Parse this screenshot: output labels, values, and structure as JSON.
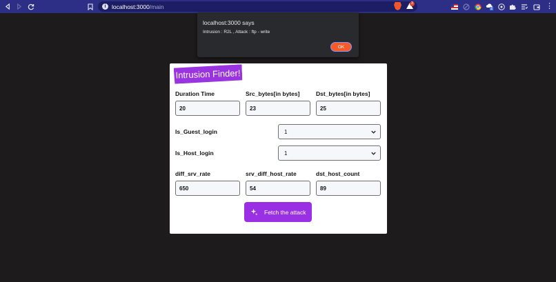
{
  "browser": {
    "url_host": "localhost:3000",
    "url_path": "/main",
    "rewards_count": "3"
  },
  "alert": {
    "title": "localhost:3000 says",
    "message": "Intrusion : R2L , Attack : ftp - write",
    "ok_label": "OK"
  },
  "form": {
    "brand": "Intrusion Finder!",
    "duration": {
      "label": "Duration Time",
      "value": "20"
    },
    "src_bytes": {
      "label": "Src_bytes[in bytes]",
      "value": "23"
    },
    "dst_bytes": {
      "label": "Dst_bytes[in bytes]",
      "value": "25"
    },
    "is_guest_login": {
      "label": "Is_Guest_login",
      "value": "1"
    },
    "is_host_login": {
      "label": "Is_Host_login",
      "value": "1"
    },
    "diff_srv_rate": {
      "label": "diff_srv_rate",
      "value": "650"
    },
    "srv_diff_host_rate": {
      "label": "srv_diff_host_rate",
      "value": "54"
    },
    "dst_host_count": {
      "label": "dst_host_count",
      "value": "89"
    },
    "fetch_label": "Fetch the attack"
  },
  "colors": {
    "toolbar": "#2d2f86",
    "accent_purple": "#9930e3",
    "ok_button": "#f55a2a",
    "page_background": "#1e1b1c"
  },
  "icons": [
    "back-icon",
    "forward-icon",
    "reload-icon",
    "bookmark-icon",
    "site-info-icon",
    "brave-shield-icon",
    "brave-rewards-icon",
    "extensions-icon",
    "reading-list-icon",
    "wallet-icon",
    "menu-icon",
    "sparkle-icon",
    "chevron-down-icon"
  ]
}
